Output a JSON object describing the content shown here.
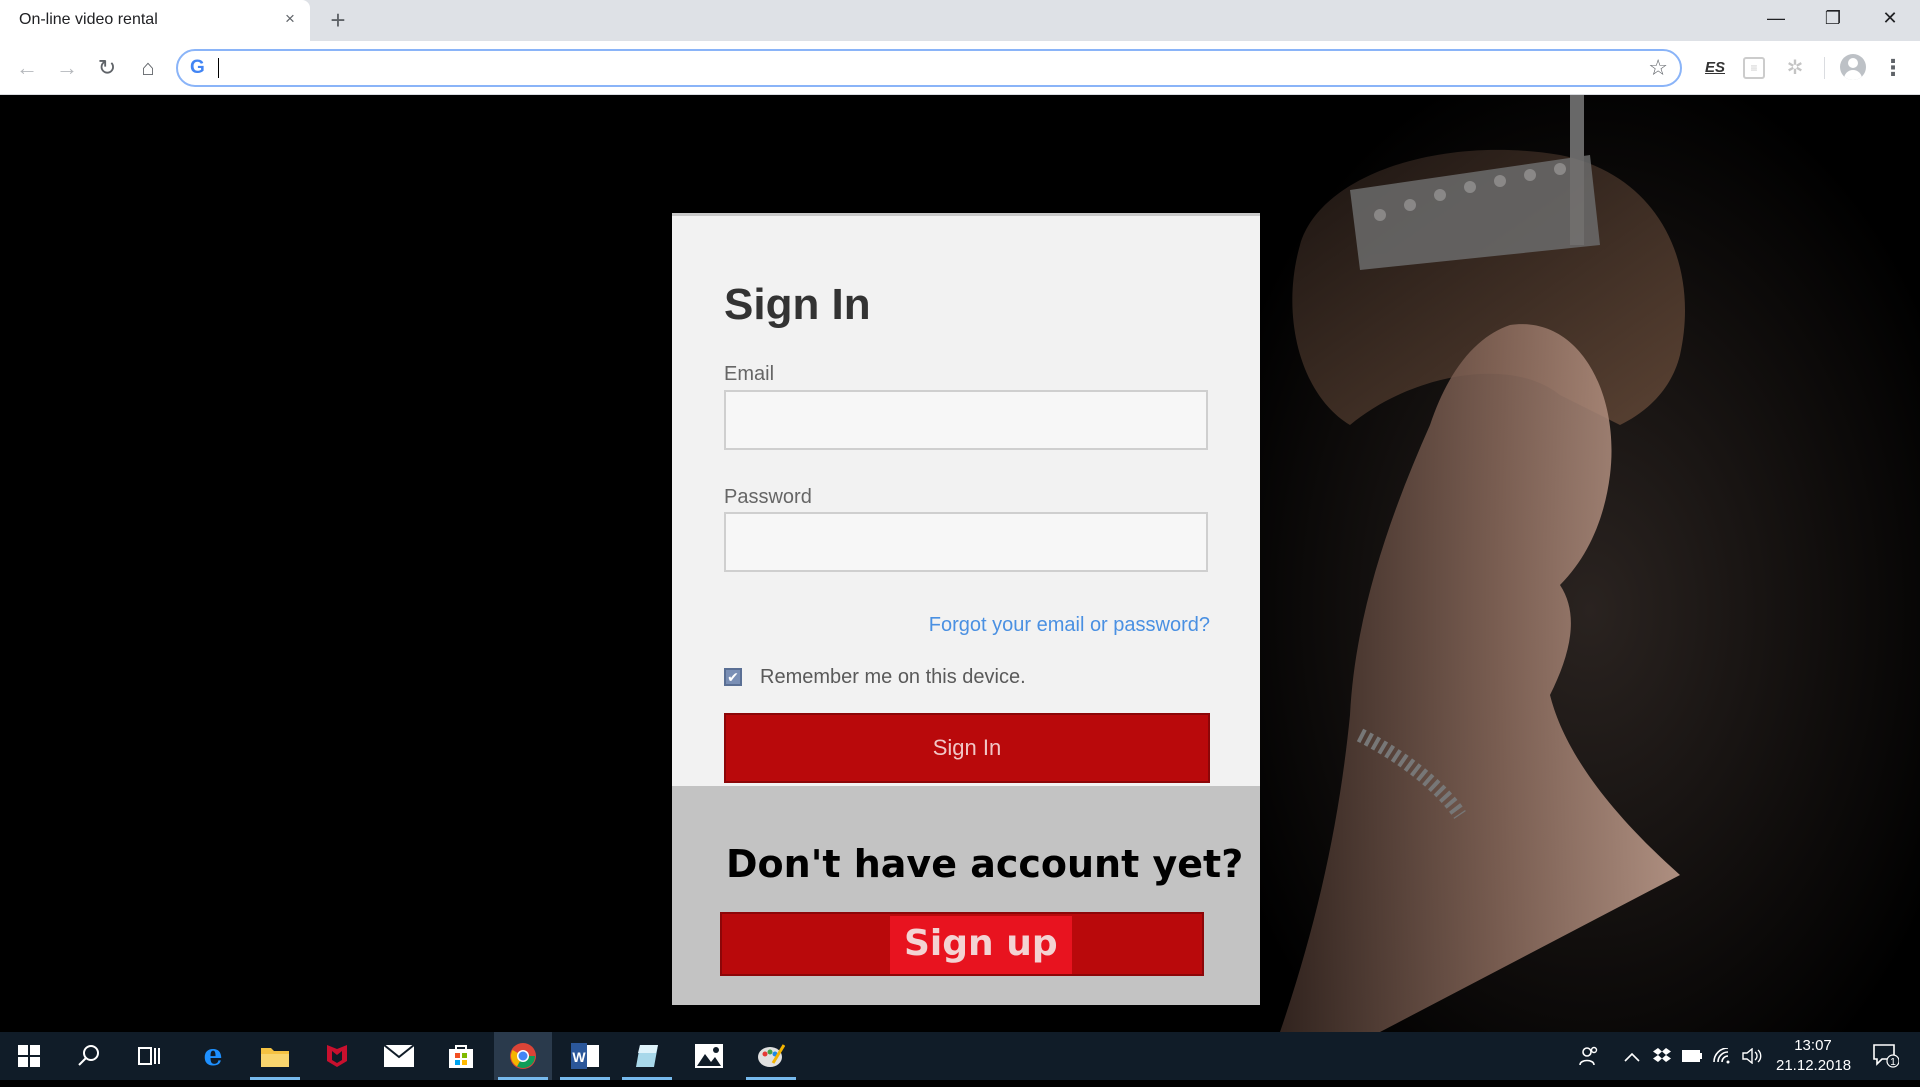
{
  "browser": {
    "tab_title": "On-line video rental",
    "tab_close": "×",
    "new_tab": "+",
    "window_controls": {
      "minimize": "—",
      "restore": "❐",
      "close": "✕"
    },
    "nav": {
      "back": "←",
      "forward": "→",
      "reload": "↻",
      "home": "⌂"
    },
    "omnibox": {
      "logo": "G",
      "value": "",
      "bookmark": "☆"
    },
    "extensions": {
      "es": "ES",
      "box": "≡",
      "puzzle": "✲"
    },
    "menu": "⋮"
  },
  "signin": {
    "title": "Sign In",
    "email_label": "Email",
    "email_value": "",
    "password_label": "Password",
    "password_value": "",
    "forgot_link": "Forgot your email or password?",
    "remember_label": "Remember me on this device.",
    "remember_checked": true,
    "remember_check_glyph": "✔",
    "submit_label": "Sign In"
  },
  "signup": {
    "prompt": "Don't have account yet?",
    "button_label": "Sign up"
  },
  "taskbar": {
    "apps": [
      {
        "name": "start",
        "icon": "windows-icon"
      },
      {
        "name": "search",
        "icon": "search-icon"
      },
      {
        "name": "task-view",
        "icon": "task-view-icon"
      },
      {
        "name": "edge",
        "icon": "edge-icon"
      },
      {
        "name": "file-explorer",
        "icon": "folder-icon"
      },
      {
        "name": "mcafee",
        "icon": "mcafee-icon"
      },
      {
        "name": "mail",
        "icon": "mail-icon"
      },
      {
        "name": "store",
        "icon": "store-icon"
      },
      {
        "name": "chrome",
        "icon": "chrome-icon",
        "active": true
      },
      {
        "name": "word",
        "icon": "word-icon"
      },
      {
        "name": "notes",
        "icon": "notes-icon"
      },
      {
        "name": "photos",
        "icon": "photos-icon"
      },
      {
        "name": "paint",
        "icon": "paint-icon"
      }
    ],
    "clock_time": "13:07",
    "clock_date": "21.12.2018",
    "notification_count": "1"
  },
  "colors": {
    "brand_red": "#b9090b",
    "signup_highlight": "#e8131f",
    "link_blue": "#4a90e2",
    "taskbar_bg": "#101c28"
  }
}
